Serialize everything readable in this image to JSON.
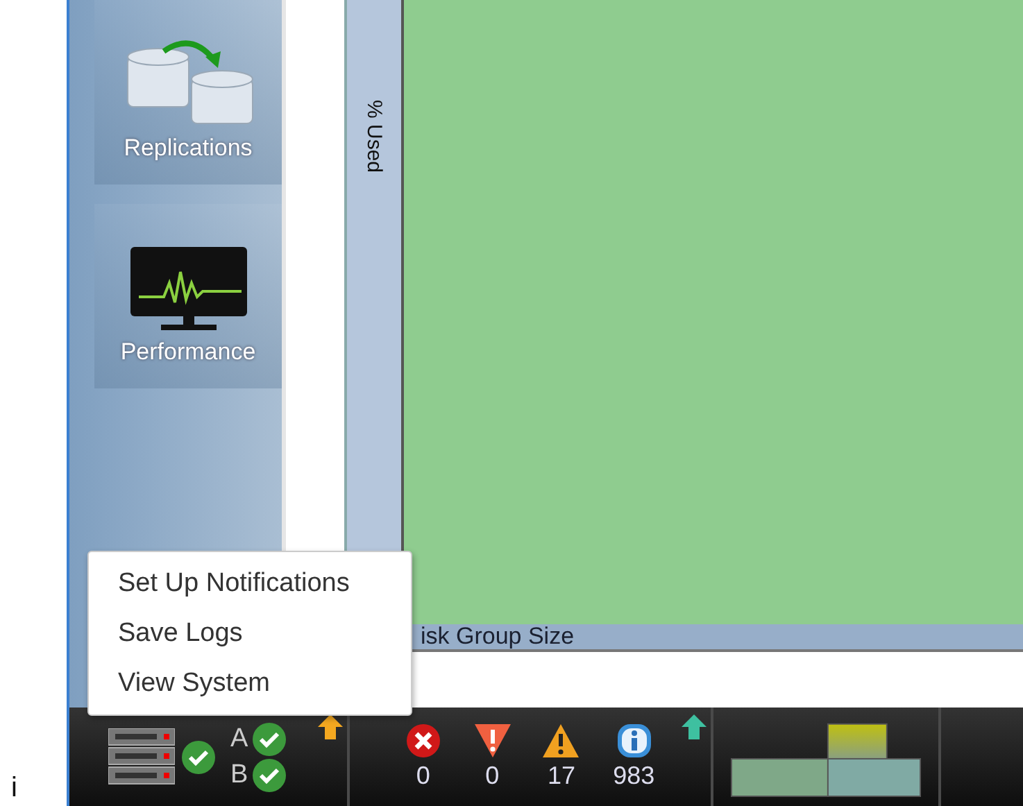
{
  "sidebar": {
    "items": [
      {
        "label": "Replications",
        "kind": "replication"
      },
      {
        "label": "Performance",
        "kind": "performance"
      }
    ]
  },
  "chart": {
    "ylabel": "% Used",
    "xlabel": "isk Group Size"
  },
  "context_menu": {
    "items": [
      "Set Up Notifications",
      "Save Logs",
      "View System"
    ]
  },
  "left_edge": {
    "text": "i"
  },
  "status_bar": {
    "system_ok": true,
    "controllers": [
      {
        "label": "A",
        "ok": true
      },
      {
        "label": "B",
        "ok": true
      }
    ],
    "alerts": [
      {
        "kind": "error",
        "count": "0"
      },
      {
        "kind": "critical",
        "count": "0"
      },
      {
        "kind": "warning",
        "count": "17"
      },
      {
        "kind": "info",
        "count": "983"
      }
    ]
  }
}
